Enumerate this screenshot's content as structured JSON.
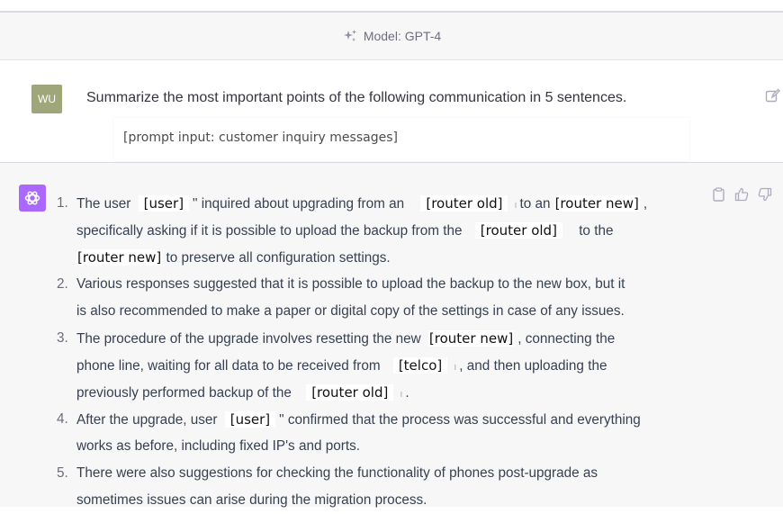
{
  "header": {
    "model_label": "Model: GPT-4"
  },
  "user": {
    "avatar_initials": "WU",
    "message": "Summarize the most important points of the following communication in 5 sentences.",
    "prompt_placeholder": "[prompt input: customer inquiry messages]"
  },
  "assistant": {
    "items": [
      {
        "number": "1.",
        "l1a": "The user",
        "r_user": "[user]",
        "l1b": "\" inquired about upgrading from an",
        "r_old": "[router old]",
        "l1c": "to an",
        "r_new": "[router new]",
        "l1d": ",",
        "l2a": "specifically asking if it is possible to upload the backup from the",
        "r_old2": "[router old]",
        "l2b": "to the",
        "r_new2": "[router new]",
        "l3": "to preserve all configuration settings."
      },
      {
        "number": "2.",
        "l1": "Various responses suggested that it is possible to upload the backup to the new box, but it",
        "l2": "is also recommended to make a paper or digital copy of the settings in case of any issues."
      },
      {
        "number": "3.",
        "l1a": "The procedure of the upgrade involves resetting the new",
        "r_new": "[router new]",
        "l1b": ", connecting the",
        "l2a": "phone line, waiting for all data to be received from",
        "r_telco": "[telco]",
        "l2b": ", and then uploading the",
        "l3a": "previously performed backup of the",
        "r_old": "[router old]",
        "l3b": "."
      },
      {
        "number": "4.",
        "l1a": "After the upgrade, user",
        "r_user": "[user]",
        "l1b": "\" confirmed that the process was successful and everything",
        "l2": "works as before, including fixed IP's and ports."
      },
      {
        "number": "5.",
        "l1": "There were also suggestions for checking the functionality of phones post-upgrade as",
        "l2": "sometimes issues can arise during the migration process."
      }
    ]
  },
  "icons": {
    "model": "sparkle-icon",
    "edit": "edit-icon",
    "copy": "clipboard-icon",
    "like": "thumbs-up-icon",
    "dislike": "thumbs-down-icon",
    "gpt": "openai-logo-icon"
  },
  "colors": {
    "gpt_avatar": "#ab68ff",
    "user_avatar": "#9fa77a",
    "assistant_bg": "#f7f7f8"
  }
}
